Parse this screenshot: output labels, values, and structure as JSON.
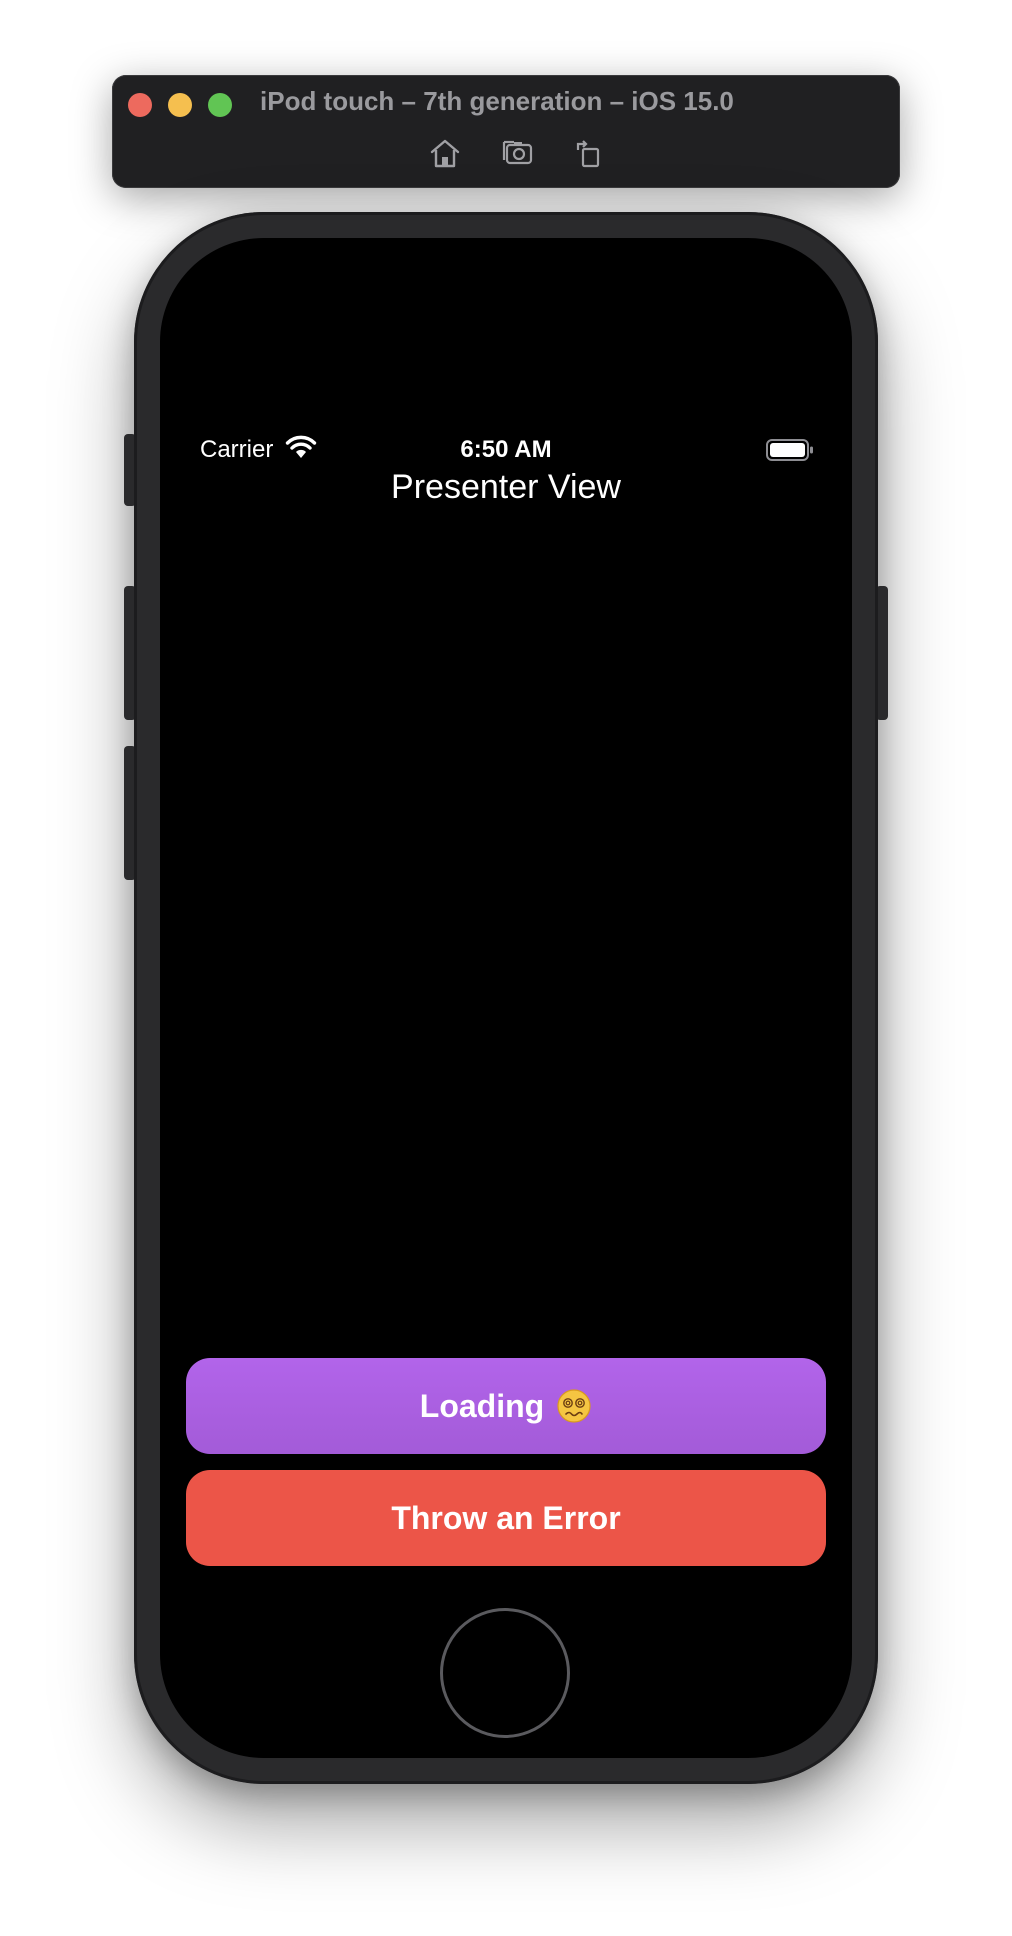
{
  "simulator": {
    "title": "iPod touch – 7th generation – iOS 15.0",
    "toolbar": {
      "home_icon": "home-icon",
      "screenshot_icon": "camera-icon",
      "rotate_icon": "rotate-icon"
    }
  },
  "status_bar": {
    "carrier": "Carrier",
    "time": "6:50 AM"
  },
  "nav": {
    "title": "Presenter View"
  },
  "buttons": {
    "loading_label": "Loading",
    "loading_emoji": "dizzy-face-emoji",
    "error_label": "Throw an Error"
  },
  "colors": {
    "loading_button": "#b264ea",
    "error_button": "#ec5548",
    "screen_background": "#000000"
  }
}
